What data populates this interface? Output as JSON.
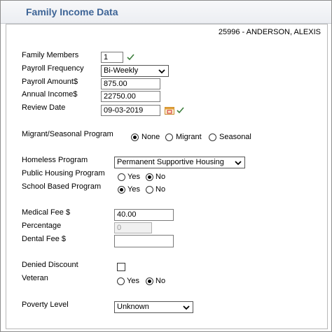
{
  "window": {
    "title": "Family Income Data"
  },
  "client": {
    "label": "25996 - ANDERSON, ALEXIS"
  },
  "fields": {
    "family_members": {
      "label": "Family Members",
      "value": "1"
    },
    "payroll_frequency": {
      "label": "Payroll Frequency",
      "value": "Bi-Weekly"
    },
    "payroll_amount": {
      "label": "Payroll Amount$",
      "value": "875.00"
    },
    "annual_income": {
      "label": "Annual Income$",
      "value": "22750.00"
    },
    "review_date": {
      "label": "Review Date",
      "value": "09-03-2019"
    },
    "migrant": {
      "label": "Migrant/Seasonal Program",
      "options": [
        "None",
        "Migrant",
        "Seasonal"
      ],
      "selected": "None"
    },
    "homeless": {
      "label": "Homeless Program",
      "value": "Permanent Supportive Housing"
    },
    "public_housing": {
      "label": "Public Housing Program",
      "options": [
        "Yes",
        "No"
      ],
      "selected": "No"
    },
    "school_based": {
      "label": "School Based Program",
      "options": [
        "Yes",
        "No"
      ],
      "selected": "Yes"
    },
    "medical_fee": {
      "label": "Medical Fee $",
      "value": "40.00"
    },
    "percentage": {
      "label": "Percentage",
      "value": "0"
    },
    "dental_fee": {
      "label": "Dental Fee $",
      "value": ""
    },
    "denied_discount": {
      "label": "Denied Discount",
      "checked": false
    },
    "veteran": {
      "label": "Veteran",
      "options": [
        "Yes",
        "No"
      ],
      "selected": "No"
    },
    "poverty_level": {
      "label": "Poverty Level",
      "value": "Unknown"
    }
  },
  "colors": {
    "title": "#3d6496",
    "check_mark": "#3a7d3a"
  },
  "icons": {
    "valid": "check-icon",
    "calendar": "calendar-icon",
    "dropdown": "chevron-down-icon"
  }
}
